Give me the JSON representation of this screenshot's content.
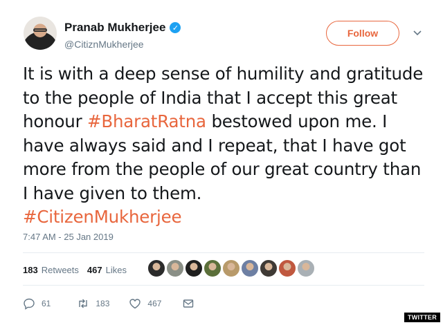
{
  "author": {
    "name": "Pranab Mukherjee",
    "handle": "@CitiznMukherjee",
    "verified_icon": "verified-check-icon"
  },
  "follow_label": "Follow",
  "tweet": {
    "seg1": "It is with a deep sense of humility and gratitude to the people of India that I accept this great honour ",
    "hashtag1": "#BharatRatna",
    "seg2": " bestowed upon me.  I have always said and I repeat, that I have got more from the people of our great country than I have given to them.",
    "hashtag2": "#CitizenMukherjee"
  },
  "timestamp": "7:47 AM - 25 Jan 2019",
  "stats": {
    "retweets_count": "183",
    "retweets_label": "Retweets",
    "likes_count": "467",
    "likes_label": "Likes"
  },
  "liker_avatar_colors": [
    "#2b2b2b",
    "#8a8f86",
    "#1f1f1f",
    "#5b6f3a",
    "#b89a6a",
    "#6d7fa3",
    "#3f3a35",
    "#c0583f",
    "#a9b0b5"
  ],
  "actions": {
    "replies": "61",
    "retweets": "183",
    "likes": "467"
  },
  "colors": {
    "accent": "#e8663d",
    "muted": "#657786",
    "verified": "#1da1f2"
  },
  "credit": "TWITTER"
}
